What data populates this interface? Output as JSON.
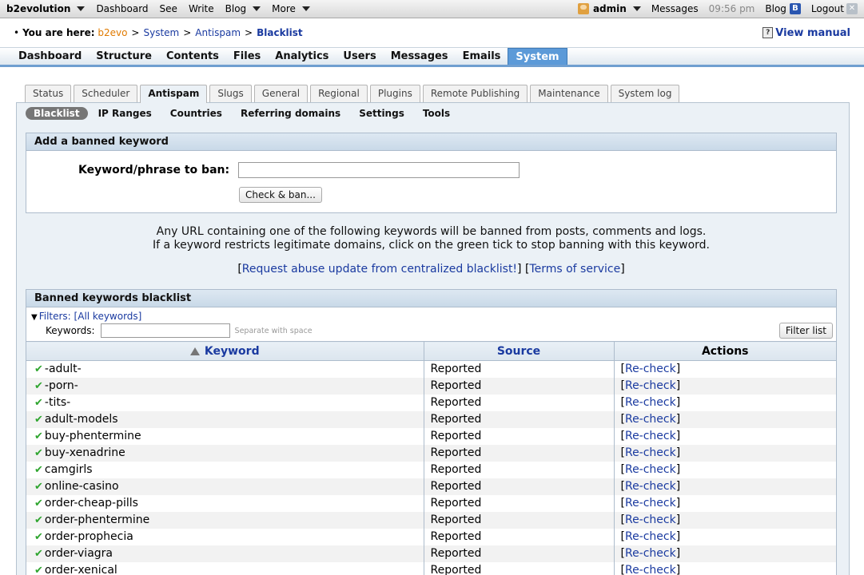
{
  "evobar": {
    "brand": "b2evolution",
    "items": [
      "Dashboard",
      "See",
      "Write",
      "Blog",
      "More"
    ],
    "user": "admin",
    "messages": "Messages",
    "time": "09:56 pm",
    "blog": "Blog",
    "blog_icon_letter": "B",
    "logout": "Logout",
    "logout_icon": "✕"
  },
  "breadcrumb": {
    "label": "You are here:",
    "home": "b2evo",
    "items": [
      "System",
      "Antispam"
    ],
    "current": "Blacklist",
    "sep": ">",
    "manual": "View manual",
    "manual_icon": "?"
  },
  "mainmenu": [
    "Dashboard",
    "Structure",
    "Contents",
    "Files",
    "Analytics",
    "Users",
    "Messages",
    "Emails",
    "System"
  ],
  "tabs": [
    "Status",
    "Scheduler",
    "Antispam",
    "Slugs",
    "General",
    "Regional",
    "Plugins",
    "Remote Publishing",
    "Maintenance",
    "System log"
  ],
  "subtabs": [
    "Blacklist",
    "IP Ranges",
    "Countries",
    "Referring domains",
    "Settings",
    "Tools"
  ],
  "add_box": {
    "title": "Add a banned keyword",
    "label": "Keyword/phrase to ban:",
    "input_value": "",
    "button": "Check & ban..."
  },
  "info": {
    "line1": "Any URL containing one of the following keywords will be banned from posts, comments and logs.",
    "line2": "If a keyword restricts legitimate domains, click on the green tick to stop banning with this keyword."
  },
  "links": {
    "request": "Request abuse update from centralized blacklist!",
    "terms": "Terms of service"
  },
  "list_box": {
    "title": "Banned keywords blacklist",
    "filters_label": "Filters:",
    "all_keywords": "[All keywords]",
    "keywords_label": "Keywords:",
    "keywords_value": "",
    "hint": "Separate with space",
    "filter_button": "Filter list",
    "columns": {
      "keyword": "Keyword",
      "source": "Source",
      "actions": "Actions"
    },
    "recheck": "Re-check",
    "rows": [
      {
        "keyword": "-adult-",
        "source": "Reported"
      },
      {
        "keyword": "-porn-",
        "source": "Reported"
      },
      {
        "keyword": "-tits-",
        "source": "Reported"
      },
      {
        "keyword": "adult-models",
        "source": "Reported"
      },
      {
        "keyword": "buy-phentermine",
        "source": "Reported"
      },
      {
        "keyword": "buy-xenadrine",
        "source": "Reported"
      },
      {
        "keyword": "camgirls",
        "source": "Reported"
      },
      {
        "keyword": "online-casino",
        "source": "Reported"
      },
      {
        "keyword": "order-cheap-pills",
        "source": "Reported"
      },
      {
        "keyword": "order-phentermine",
        "source": "Reported"
      },
      {
        "keyword": "order-prophecia",
        "source": "Reported"
      },
      {
        "keyword": "order-viagra",
        "source": "Reported"
      },
      {
        "keyword": "order-xenical",
        "source": "Reported"
      }
    ]
  }
}
